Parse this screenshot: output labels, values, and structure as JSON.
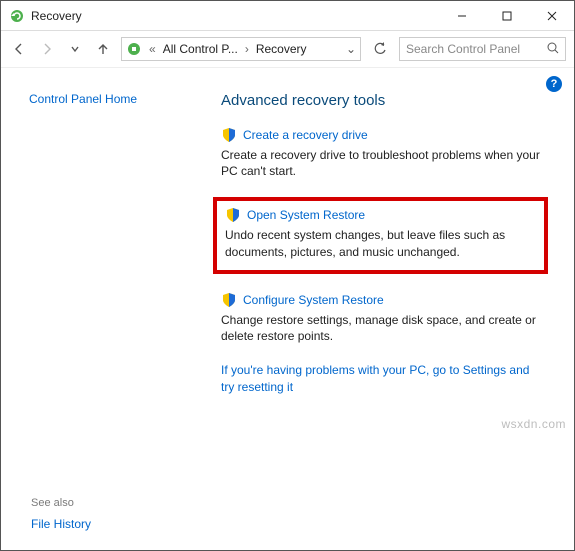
{
  "window": {
    "title": "Recovery"
  },
  "breadcrumb": {
    "item1": "All Control P...",
    "item2": "Recovery"
  },
  "search": {
    "placeholder": "Search Control Panel"
  },
  "sidebar": {
    "home_link": "Control Panel Home",
    "see_also_label": "See also",
    "file_history_link": "File History"
  },
  "main": {
    "heading": "Advanced recovery tools",
    "items": [
      {
        "title": "Create a recovery drive",
        "desc": "Create a recovery drive to troubleshoot problems when your PC can't start."
      },
      {
        "title": "Open System Restore",
        "desc": "Undo recent system changes, but leave files such as documents, pictures, and music unchanged."
      },
      {
        "title": "Configure System Restore",
        "desc": "Change restore settings, manage disk space, and create or delete restore points."
      }
    ],
    "trouble_link": "If you're having problems with your PC, go to Settings and try resetting it"
  },
  "help_badge": "?",
  "watermark": "wsxdn.com"
}
